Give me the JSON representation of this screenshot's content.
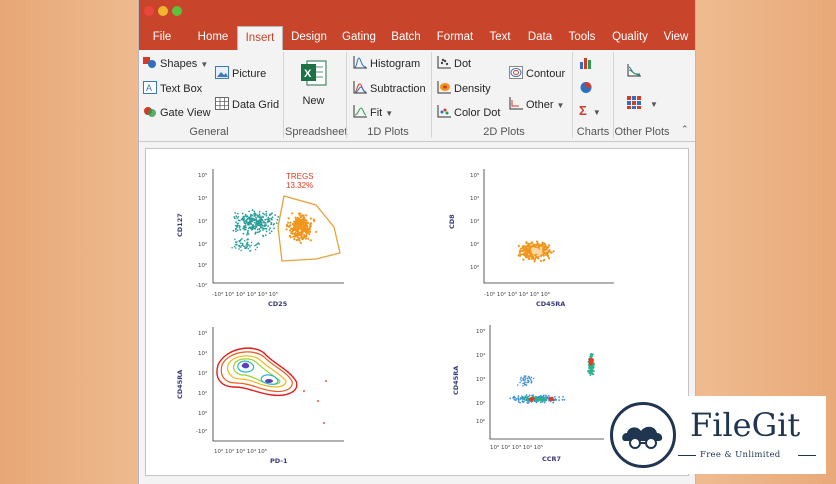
{
  "tabs": [
    "File",
    "Home",
    "Insert",
    "Design",
    "Gating",
    "Batch",
    "Format",
    "Text",
    "Data",
    "Tools",
    "Quality",
    "View"
  ],
  "active_tab": "Insert",
  "ribbon": {
    "general": {
      "shapes": "Shapes",
      "picture": "Picture",
      "text_box": "Text Box",
      "gate_view": "Gate View",
      "data_grid": "Data Grid",
      "label": "General"
    },
    "spreadsheet": {
      "new": "New",
      "label": "Spreadsheet"
    },
    "plots_1d": {
      "histogram": "Histogram",
      "subtraction": "Subtraction",
      "fit": "Fit",
      "label": "1D Plots"
    },
    "plots_2d": {
      "dot": "Dot",
      "density": "Density",
      "color_dot": "Color Dot",
      "contour": "Contour",
      "other": "Other",
      "label": "2D Plots"
    },
    "charts": {
      "label": "Charts"
    },
    "other_plots": {
      "label": "Other Plots"
    }
  },
  "plots": {
    "p1": {
      "xlabel": "CD25",
      "ylabel": "CD127",
      "gate_name": "TREGS",
      "gate_pct": "13.32%"
    },
    "p2": {
      "xlabel": "CD45RA",
      "ylabel": "CD8"
    },
    "p3": {
      "xlabel": "PD-1",
      "ylabel": "CD45RA"
    },
    "p4": {
      "xlabel": "CCR7",
      "ylabel": "CD45RA"
    }
  },
  "logo": {
    "name": "FileGit",
    "tagline": "Free & Unlimited"
  },
  "colors": {
    "titlebar": "#c8452b",
    "teal": "#2a9d9a",
    "orange": "#f0961e",
    "gate": "#e8a23a"
  }
}
